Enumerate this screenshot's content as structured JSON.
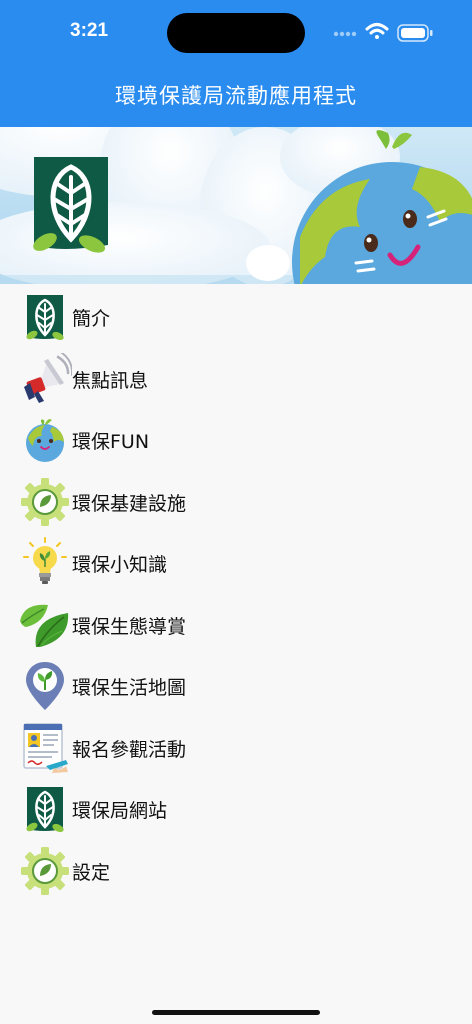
{
  "status_bar": {
    "time": "3:21"
  },
  "header": {
    "title": "環境保護局流動應用程式"
  },
  "colors": {
    "header_bg": "#2b8cf0",
    "logo_green": "#0e5a44",
    "leaf_green": "#8cc63f",
    "text": "#111111"
  },
  "menu": {
    "items": [
      {
        "label": "簡介",
        "icon": "epd-logo-icon"
      },
      {
        "label": "焦點訊息",
        "icon": "megaphone-icon"
      },
      {
        "label": "環保FUN",
        "icon": "earth-icon"
      },
      {
        "label": "環保基建設施",
        "icon": "gear-leaf-icon"
      },
      {
        "label": "環保小知識",
        "icon": "lightbulb-icon"
      },
      {
        "label": "環保生態導賞",
        "icon": "leaf-icon"
      },
      {
        "label": "環保生活地圖",
        "icon": "map-pin-icon"
      },
      {
        "label": "報名參觀活動",
        "icon": "registration-form-icon"
      },
      {
        "label": "環保局網站",
        "icon": "epd-logo-icon"
      },
      {
        "label": "設定",
        "icon": "settings-gear-icon"
      }
    ]
  }
}
